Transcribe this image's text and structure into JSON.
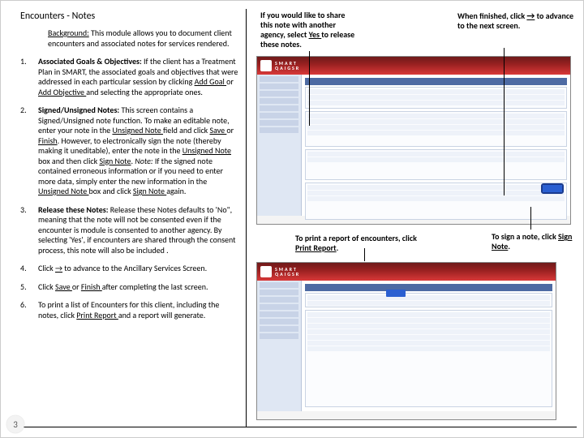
{
  "title": "Encounters - Notes",
  "background_label": "Background:",
  "background_text": "This module allows you to document client encounters and associated notes for services rendered.",
  "items": [
    {
      "num": "1.",
      "lead": "Associated Goals & Objectives:",
      "rest": " If the client has a Treatment Plan in SMART,  the associated goals and objectives that were addressed in each particular session by clicking ",
      "link1": "Add Goal ",
      "mid1": "or ",
      "link2": "Add Objective ",
      "tail": "and selecting the appropriate ones."
    },
    {
      "num": "2.",
      "lead": "Signed/Unsigned Notes:",
      "rest": " This screen contains a Signed/Unsigned note function.  To make an editable note, enter your note in the ",
      "link1": "Unsigned Note ",
      "mid1": "field and click ",
      "link2": "Save ",
      "mid2": "or ",
      "link3": "Finish",
      "mid3": ".  However, to electronically sign the note (thereby making it uneditable), enter the note in the ",
      "link4": "Unsigned Note ",
      "mid4": "box and then click ",
      "link5": "Sign Note",
      "mid5": ".  ",
      "note_lead": "Note:",
      "note_rest": " If the signed note contained erroneous information or if you need to enter more data, simply enter the new information in the ",
      "link6": "Unsigned Note ",
      "mid6": "box and click ",
      "link7": "Sign Note ",
      "tail": "again."
    },
    {
      "num": "3.",
      "lead": "Release these Notes:",
      "rest": "  Release these Notes defaults to 'No\", meaning that the note  will not be consented even if the encounter is module is consented to another agency.  By selecting 'Yes', if encounters are shared through the consent process, this note will also be included .",
      "tail": ""
    },
    {
      "num": "4.",
      "lead": "",
      "rest": "Click ",
      "arrow": "→",
      "tail": " to advance to the Ancillary Services Screen."
    },
    {
      "num": "5.",
      "lead": "",
      "rest": "Click ",
      "link1": "Save ",
      "mid1": "or ",
      "link2": "Finish ",
      "tail": "after completing the last screen."
    },
    {
      "num": "6.",
      "lead": "",
      "rest": "To print a list of Encounters for this client, including the notes, click ",
      "link1": "Print Report ",
      "tail": "and a report will generate."
    }
  ],
  "callouts": {
    "share_a": "If you would like to share this note with another agency, select ",
    "share_yes": "Yes ",
    "share_b": "to release these notes.",
    "finish_a": "When finished, click ",
    "finish_arrow": "→",
    "finish_b": " to advance to the next screen.",
    "print_a": "To print a report of encounters, click ",
    "print_link": "Print Report",
    "print_b": ".",
    "sign_a": "To sign a note, click ",
    "sign_link": "Sign Note",
    "sign_b": "."
  },
  "page_number": "3",
  "shots": {
    "brand1": "S M A R T",
    "brand2": "Q A  I G S R"
  }
}
